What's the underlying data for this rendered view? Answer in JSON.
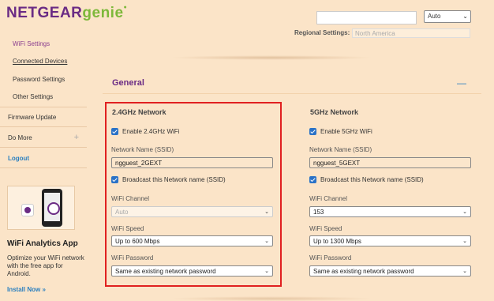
{
  "header": {
    "brand": "NETGEAR",
    "genie": "genie",
    "search_placeholder": "",
    "language": "Auto"
  },
  "sidebar": {
    "items": [
      {
        "label": "WiFi Settings"
      },
      {
        "label": "Connected Devices"
      },
      {
        "label": "Password Settings"
      },
      {
        "label": "Other Settings"
      },
      {
        "label": "Firmware Update"
      },
      {
        "label": "Do More"
      },
      {
        "label": "Logout"
      }
    ]
  },
  "promo": {
    "title": "WiFi Analytics App",
    "text": "Optimize your WiFi network with the free app for Android.",
    "link": "Install Now »"
  },
  "regional": {
    "label": "Regional Settings:",
    "value": "North America"
  },
  "section": {
    "title": "General",
    "collapse": "—"
  },
  "band24": {
    "title": "2.4GHz Network",
    "enable_label": "Enable 2.4GHz WiFi",
    "ssid_label": "Network Name (SSID)",
    "ssid_value": "ngguest_2GEXT",
    "broadcast_label": "Broadcast this Network name (SSID)",
    "channel_label": "WiFi Channel",
    "channel_value": "Auto",
    "speed_label": "WiFi Speed",
    "speed_value": "Up to 600 Mbps",
    "password_label": "WiFi Password",
    "password_value": "Same as existing network password"
  },
  "band5": {
    "title": "5GHz Network",
    "enable_label": "Enable 5GHz WiFi",
    "ssid_label": "Network Name (SSID)",
    "ssid_value": "ngguest_5GEXT",
    "broadcast_label": "Broadcast this Network name (SSID)",
    "channel_label": "WiFi Channel",
    "channel_value": "153",
    "speed_label": "WiFi Speed",
    "speed_value": "Up to 1300 Mbps",
    "password_label": "WiFi Password",
    "password_value": "Same as existing network password"
  },
  "colors": {
    "background": "#fbe4c8",
    "brand_purple": "#6a2b84",
    "genie_green": "#7db83a",
    "link_blue": "#2a7fbf",
    "highlight_red": "#e02020"
  }
}
